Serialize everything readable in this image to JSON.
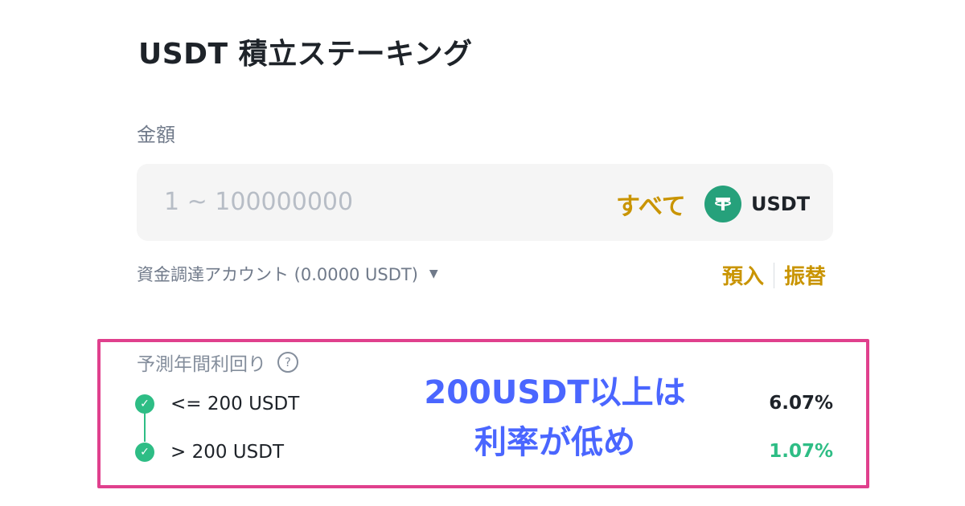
{
  "header": {
    "title": "USDT 積立ステーキング"
  },
  "amount": {
    "label": "金額",
    "placeholder": "1 ~ 100000000",
    "max_label": "すべて",
    "coin_name": "USDT",
    "coin_icon": "tether-icon",
    "coin_color": "#26a17b"
  },
  "account": {
    "label": "資金調達アカウント (0.0000 USDT)",
    "deposit_label": "預入",
    "transfer_label": "振替"
  },
  "apr": {
    "label": "予測年間利回り",
    "tiers": [
      {
        "range": "<= 200 USDT",
        "rate": "6.07%",
        "rate_color": "#1e2329"
      },
      {
        "range": "> 200 USDT",
        "rate": "1.07%",
        "rate_color": "#2ebd85"
      }
    ]
  },
  "annotation": {
    "line1": "200USDT以上は",
    "line2": "利率が低め",
    "highlight_color": "#e0408d",
    "text_color": "#4a66ff"
  },
  "colors": {
    "accent": "#c99400",
    "success": "#2ebd85"
  }
}
